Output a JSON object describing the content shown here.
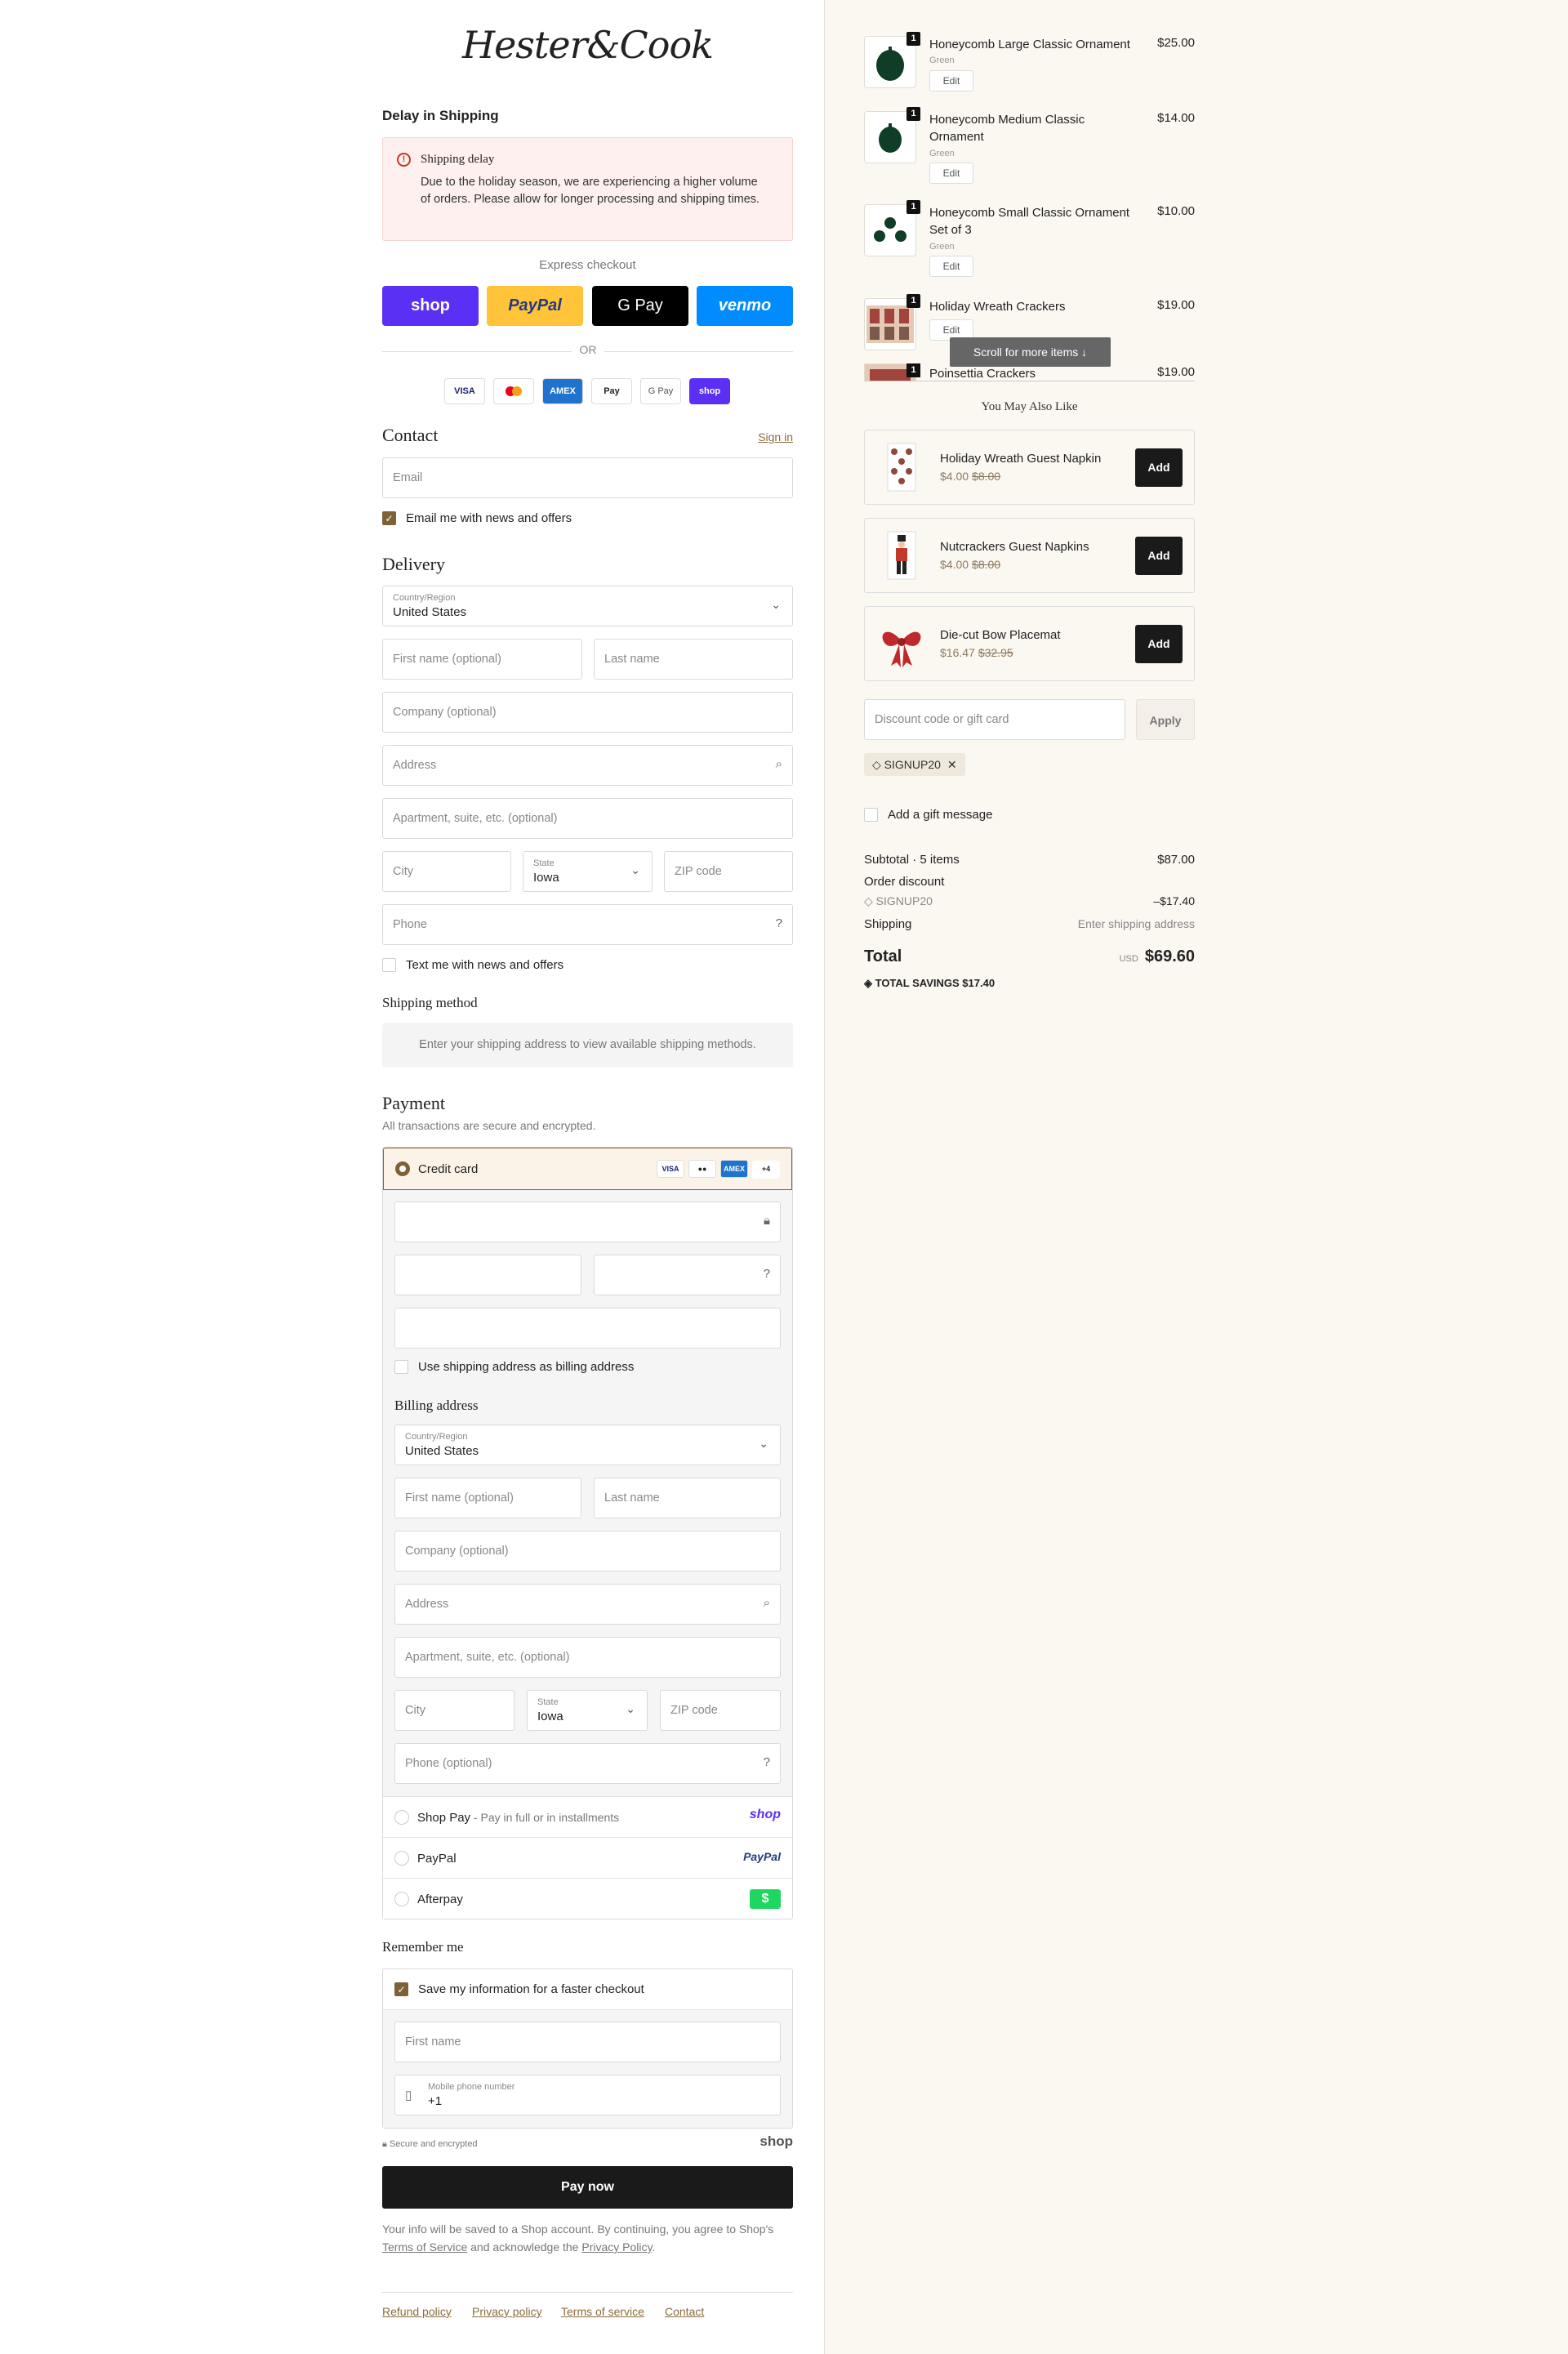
{
  "brand": {
    "logo_text": "Hester&Cook"
  },
  "notice": {
    "heading": "Delay in Shipping",
    "title": "Shipping delay",
    "body": "Due to the holiday season, we are experiencing a higher volume of orders. Please allow for longer processing and shipping times."
  },
  "express": {
    "label": "Express checkout",
    "buttons": [
      "shop",
      "PayPal",
      "G Pay",
      "venmo"
    ],
    "or": "OR"
  },
  "payment_icons": [
    "VISA",
    "MC",
    "AMEX",
    "Pay",
    "G Pay",
    "shop"
  ],
  "contact": {
    "title": "Contact",
    "sign_in": "Sign in",
    "email_placeholder": "Email",
    "news_label": "Email me with news and offers"
  },
  "delivery": {
    "title": "Delivery",
    "country_label": "Country/Region",
    "country_value": "United States",
    "first_name": "First name (optional)",
    "last_name": "Last name",
    "company": "Company (optional)",
    "address": "Address",
    "apartment": "Apartment, suite, etc. (optional)",
    "city": "City",
    "state_label": "State",
    "state_value": "Iowa",
    "zip": "ZIP code",
    "phone": "Phone",
    "text_label": "Text me with news and offers"
  },
  "shipping_method": {
    "title": "Shipping method",
    "message": "Enter your shipping address to view available shipping methods."
  },
  "payment": {
    "title": "Payment",
    "subtitle": "All transactions are secure and encrypted.",
    "credit_card_label": "Credit card",
    "card_more": "+4",
    "use_shipping_label": "Use shipping address as billing address",
    "billing_title": "Billing address",
    "billing": {
      "country_label": "Country/Region",
      "country_value": "United States",
      "first_name": "First name (optional)",
      "last_name": "Last name",
      "company": "Company (optional)",
      "address": "Address",
      "apartment": "Apartment, suite, etc. (optional)",
      "city": "City",
      "state_label": "State",
      "state_value": "Iowa",
      "zip": "ZIP code",
      "phone": "Phone (optional)"
    },
    "shop_pay_label": "Shop Pay",
    "shop_pay_sub": " - Pay in full or in installments",
    "shop_logo": "shop",
    "paypal_label": "PayPal",
    "paypal_logo": "PayPal",
    "afterpay_label": "Afterpay"
  },
  "remember": {
    "title": "Remember me",
    "save_label": "Save my information for a faster checkout",
    "first_name": "First name",
    "mobile_label": "Mobile phone number",
    "mobile_value": "+1",
    "secure": "Secure and encrypted",
    "shop_logo": "shop"
  },
  "pay_now": "Pay now",
  "legal": {
    "pre": "Your info will be saved to a Shop account. By continuing, you agree to Shop's ",
    "tos": "Terms of Service",
    "mid": " and acknowledge the ",
    "privacy": "Privacy Policy",
    "end": "."
  },
  "footer_links": [
    "Refund policy",
    "Privacy policy",
    "Terms of service",
    "Contact"
  ],
  "cart": {
    "items": [
      {
        "name": "Honeycomb Large Classic Ornament",
        "variant": "Green",
        "qty": "1",
        "price": "$25.00",
        "edit": "Edit"
      },
      {
        "name": "Honeycomb Medium Classic Ornament",
        "variant": "Green",
        "qty": "1",
        "price": "$14.00",
        "edit": "Edit"
      },
      {
        "name": "Honeycomb Small Classic Ornament Set of 3",
        "variant": "Green",
        "qty": "1",
        "price": "$10.00",
        "edit": "Edit"
      },
      {
        "name": "Holiday Wreath Crackers",
        "variant": "",
        "qty": "1",
        "price": "$19.00",
        "edit": "Edit"
      },
      {
        "name": "Poinsettia Crackers",
        "variant": "",
        "qty": "1",
        "price": "$19.00",
        "edit": ""
      }
    ],
    "scroll_hint": "Scroll for more items"
  },
  "upsell": {
    "title": "You May Also Like",
    "items": [
      {
        "name": "Holiday Wreath Guest Napkin",
        "price": "$4.00",
        "old": "$8.00",
        "add": "Add"
      },
      {
        "name": "Nutcrackers Guest Napkins",
        "price": "$4.00",
        "old": "$8.00",
        "add": "Add"
      },
      {
        "name": "Die-cut Bow Placemat",
        "price": "$16.47",
        "old": "$32.95",
        "add": "Add"
      }
    ]
  },
  "discount": {
    "placeholder": "Discount code or gift card",
    "apply": "Apply",
    "code": "SIGNUP20"
  },
  "gift_label": "Add a gift message",
  "summary": {
    "subtotal_label": "Subtotal · 5 items",
    "subtotal": "$87.00",
    "order_discount": "Order discount",
    "code": "SIGNUP20",
    "discount": "–$17.40",
    "shipping_label": "Shipping",
    "shipping_value": "Enter shipping address",
    "total_label": "Total",
    "currency": "USD",
    "total": "$69.60",
    "savings_label": "TOTAL SAVINGS",
    "savings": "$17.40"
  },
  "colors": {
    "accent": "#7d6238",
    "shop": "#5a31f4",
    "paypal": "#ffc439",
    "venmo": "#008cff"
  }
}
